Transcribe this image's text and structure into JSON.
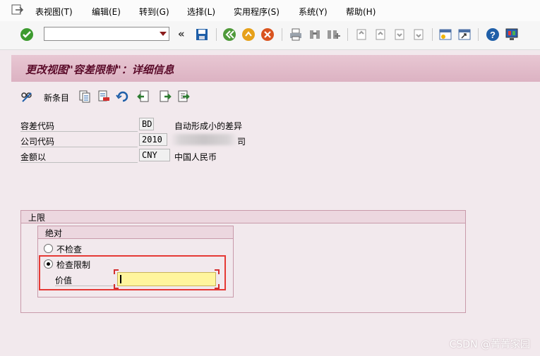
{
  "menu": {
    "items": [
      "表视图(T)",
      "编辑(E)",
      "转到(G)",
      "选择(L)",
      "实用程序(S)",
      "系统(Y)",
      "帮助(H)"
    ]
  },
  "toolbar": {
    "command_value": "",
    "icons": [
      "enter-icon",
      "back-icon",
      "exit-icon",
      "cancel-icon",
      "print-icon",
      "find-icon",
      "find-next-icon",
      "first-page-icon",
      "previous-page-icon",
      "next-page-icon",
      "last-page-icon",
      "create-session-icon",
      "shortcut-icon",
      "help-icon",
      "layout-icon",
      "save-icon",
      "collapse-icon"
    ]
  },
  "title": "更改视图\"容差限制\"：详细信息",
  "app_toolbar": {
    "new_entries_label": "新条目"
  },
  "fields": {
    "tolerance_code_label": "容差代码",
    "tolerance_code_value": "BD",
    "tolerance_code_desc": "自动形成小的差异",
    "company_code_label": "公司代码",
    "company_code_value": "2010",
    "company_code_desc_suffix": "司",
    "amount_label": "金额以",
    "amount_value": "CNY",
    "amount_desc": "中国人民币"
  },
  "upper_limit": {
    "title": "上限",
    "absolute": {
      "title": "绝对",
      "no_check_label": "不检查",
      "check_limit_label": "检查限制",
      "selected": "check_limit",
      "value_label": "价值",
      "value": ""
    }
  },
  "watermark": "CSDN @菁菁家园",
  "colors": {
    "title_bar": "#dcb2c2",
    "title_text": "#5b0b2a",
    "highlight": "#e53935",
    "input_required": "#fff59d",
    "background": "#f2e9ed"
  }
}
